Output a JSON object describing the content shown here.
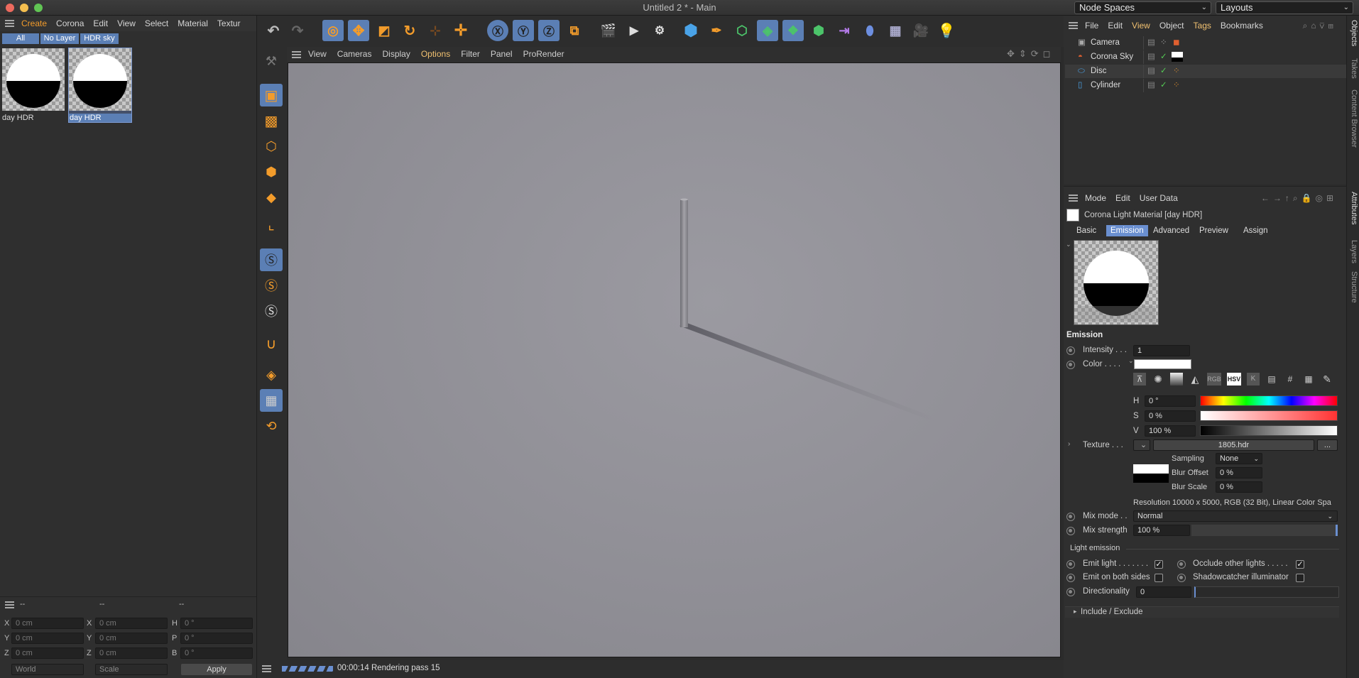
{
  "window": {
    "title": "Untitled 2 * - Main",
    "node_spaces": "Node Spaces",
    "layouts": "Layouts"
  },
  "material_manager": {
    "menu": [
      "Create",
      "Corona",
      "Edit",
      "View",
      "Select",
      "Material",
      "Textur"
    ],
    "filters": [
      "All",
      "No Layer",
      "HDR sky"
    ],
    "materials": [
      {
        "name": "day HDR"
      },
      {
        "name": "day HDR"
      }
    ]
  },
  "viewport": {
    "menu": [
      "View",
      "Cameras",
      "Display",
      "Options",
      "Filter",
      "Panel",
      "ProRender"
    ],
    "status": "00:00:14 Rendering pass 15"
  },
  "coordinates": {
    "headers": [
      "--",
      "--",
      "--"
    ],
    "rows": [
      {
        "a": "X",
        "av": "0 cm",
        "b": "X",
        "bv": "0 cm",
        "c": "H",
        "cv": "0 °"
      },
      {
        "a": "Y",
        "av": "0 cm",
        "b": "Y",
        "bv": "0 cm",
        "c": "P",
        "cv": "0 °"
      },
      {
        "a": "Z",
        "av": "0 cm",
        "b": "Z",
        "bv": "0 cm",
        "c": "B",
        "cv": "0 °"
      }
    ],
    "mode": "World",
    "scale": "Scale",
    "apply": "Apply"
  },
  "objects": {
    "menu": [
      "File",
      "Edit",
      "View",
      "Object",
      "Tags",
      "Bookmarks"
    ],
    "items": [
      "Camera",
      "Corona Sky",
      "Disc",
      "Cylinder"
    ]
  },
  "attributes": {
    "menu": [
      "Mode",
      "Edit",
      "User Data"
    ],
    "material_title": "Corona Light Material [day HDR]",
    "tabs": [
      "Basic",
      "Emission",
      "Advanced",
      "Preview",
      "Assign"
    ],
    "section": "Emission",
    "intensity_label": "Intensity . . .",
    "intensity": "1",
    "color_label": "Color . . . .",
    "h_label": "H",
    "h": "0 °",
    "s_label": "S",
    "s": "0 %",
    "v_label": "V",
    "v": "100 %",
    "texture_label": "Texture . . .",
    "texture_file": "1805.hdr",
    "sampling_label": "Sampling",
    "sampling": "None",
    "blur_offset_label": "Blur Offset",
    "blur_offset": "0 %",
    "blur_scale_label": "Blur Scale",
    "blur_scale": "0 %",
    "resolution": "Resolution 10000 x 5000, RGB (32 Bit), Linear Color Spa",
    "mix_mode_label": "Mix mode . .",
    "mix_mode": "Normal",
    "mix_strength_label": "Mix strength",
    "mix_strength": "100 %",
    "light_emission": "Light emission",
    "emit_light": "Emit light . . . . . . .",
    "occlude": "Occlude other lights . . . . .",
    "emit_both": "Emit on both sides",
    "shadowcatcher": "Shadowcatcher illuminator",
    "directionality_label": "Directionality",
    "directionality": "0",
    "include_exclude": "Include / Exclude",
    "color_mode_buttons": [
      "RGB",
      "HSV",
      "K",
      "#"
    ]
  },
  "side_tabs": {
    "top": [
      "Objects",
      "Takes",
      "Content Browser"
    ],
    "bottom": [
      "Attributes",
      "Layers",
      "Structure"
    ]
  },
  "colors": {
    "accent_orange": "#f39c2b",
    "selection_blue": "#5b7fb5",
    "active_tab": "#6a8fd0"
  }
}
